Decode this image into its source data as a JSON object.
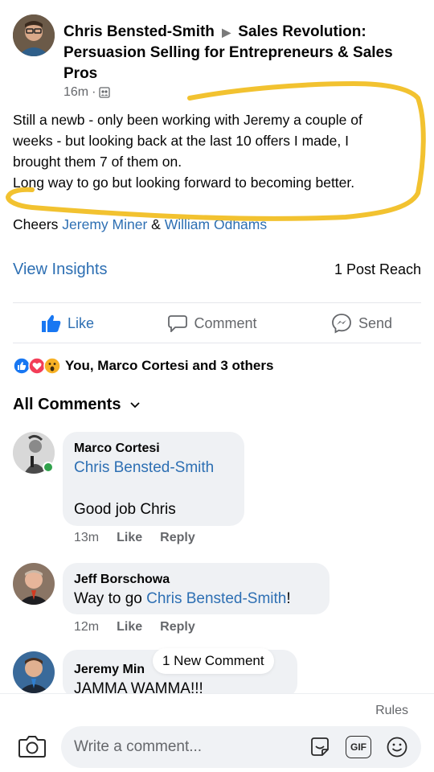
{
  "post": {
    "author": "Chris Bensted-Smith",
    "separator": "▶",
    "group": "Sales Revolution: Persuasion Selling for Entrepreneurs & Sales Pros",
    "time": "16m",
    "separator_dot": "·",
    "text_lines": [
      "Still a newb - only been working with Jeremy a couple of",
      "weeks - but looking back at the last 10 offers I made, I",
      "brought them 7 of them on.",
      "Long way to go but looking forward to becoming better."
    ],
    "cheers_prefix": "Cheers",
    "tag1": "Jeremy Miner",
    "cheers_and": "&",
    "tag2": "William Odhams"
  },
  "insights": {
    "view_label": "View Insights",
    "reach_label": "1 Post Reach"
  },
  "actions": {
    "like": "Like",
    "comment": "Comment",
    "send": "Send"
  },
  "reactions": {
    "summary": "You, Marco Cortesi and 3 others"
  },
  "comments_header": "All Comments",
  "comments": [
    {
      "author": "Marco Cortesi",
      "mention": "Chris Bensted-Smith",
      "text": "Good job Chris",
      "time": "13m",
      "like": "Like",
      "reply": "Reply"
    },
    {
      "author": "Jeff Borschowa",
      "text_prefix": "Way to go",
      "mention": "Chris Bensted-Smith",
      "text_suffix": "!",
      "time": "12m",
      "like": "Like",
      "reply": "Reply"
    },
    {
      "author": "Jeremy Min",
      "text": "JAMMA WAMMA!!!"
    }
  ],
  "new_comment_pill": "1 New Comment",
  "composer": {
    "rules": "Rules",
    "placeholder": "Write a comment...",
    "gif": "GIF"
  },
  "colors": {
    "link": "#2d6fb3",
    "highlight": "#f2c230",
    "like_blue": "#1877f2",
    "love_red": "#f33e58",
    "wow_yellow": "#f7b125"
  }
}
